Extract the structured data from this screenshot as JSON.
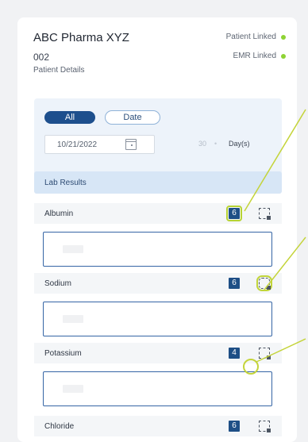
{
  "patient": {
    "name": "ABC Pharma XYZ",
    "id": "002",
    "details_label": "Patient Details",
    "status": [
      {
        "label": "Patient Linked",
        "color": "#8ed334"
      },
      {
        "label": "EMR Linked",
        "color": "#8ed334"
      }
    ]
  },
  "filter": {
    "all_label": "All",
    "date_label": "Date",
    "selected": "All",
    "date_value": "10/21/2022",
    "days_value": "30",
    "days_unit": "Day(s)"
  },
  "lab": {
    "header": "Lab Results",
    "items": [
      {
        "label": "Albumin",
        "count": "6"
      },
      {
        "label": "Sodium",
        "count": "6"
      },
      {
        "label": "Potassium",
        "count": "4"
      },
      {
        "label": "Chloride",
        "count": "6"
      }
    ]
  },
  "icons": {
    "calendar": "calendar-icon",
    "expand": "expand-icon"
  },
  "colors": {
    "primary": "#1d4f8d",
    "accent": "#b7d333",
    "status_green": "#8ed334"
  }
}
